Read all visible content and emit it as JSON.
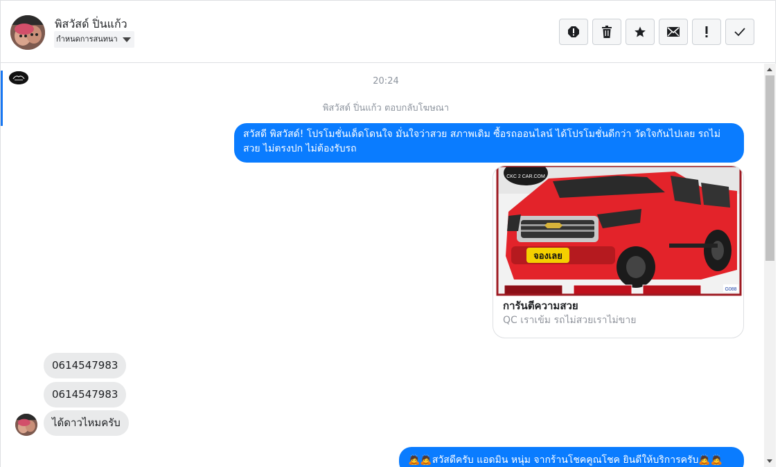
{
  "header": {
    "contact_name": "พิสวัสด์ ปิ่นแก้ว",
    "assign_label": "กำหนดการสนทนา",
    "toolbar": [
      {
        "icon": "report-spam-icon"
      },
      {
        "icon": "trash-icon"
      },
      {
        "icon": "star-icon"
      },
      {
        "icon": "mark-unread-icon"
      },
      {
        "icon": "follow-up-icon"
      },
      {
        "icon": "mark-done-icon"
      }
    ]
  },
  "thread": {
    "timestamp": "20:24",
    "reply_note": "พิสวัสด์ ปิ่นแก้ว ตอบกลับโฆษณา",
    "outgoing_message": "สวัสดี พิสวัสด์! โปรโมชั่นเด็ดโดนใจ มั่นใจว่าสวย สภาพเดิม ซื้อรถออนไลน์ ได้โปรโมชั่นดีกว่า วัดใจกันไปเลย รถไม่สวย ไม่ตรงปก ไม่ต้องรับรถ",
    "ad_card": {
      "image_brand": "CKC 2 CAR.COM",
      "image_badge": "จองเลย",
      "image_code": "G088",
      "title": "การันตีความสวย",
      "subtitle": "QC เราเข้ม รถไม่สวยเราไม่ขาย"
    },
    "incoming": [
      "0614547983",
      "0614547983",
      "ได้ดาวไหมครับ"
    ],
    "last_outgoing": "🙇🙇สวัสดีครับ แอดมิน หนุ่ม จากร้านโชคคูณโชค ยินดีให้บริการครับ🙇🙇"
  },
  "colors": {
    "accent": "#1877f2",
    "outgoing_bubble": "#0a7cff",
    "incoming_bubble": "#e9eaeb"
  }
}
